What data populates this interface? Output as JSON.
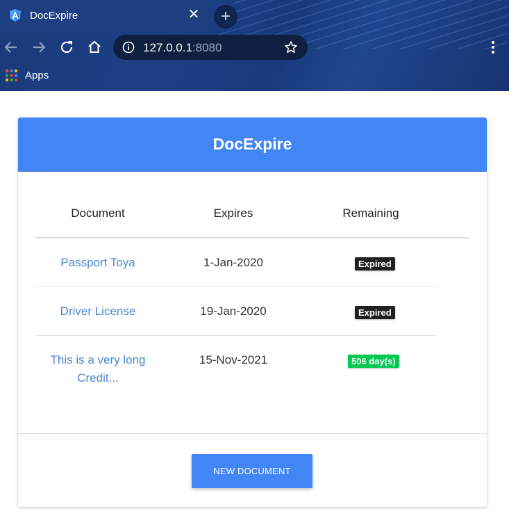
{
  "browser": {
    "tab": {
      "title": "DocExpire",
      "favicon": "angular-icon"
    },
    "address": {
      "host": "127.0.0.1",
      "port": ":8080"
    },
    "bookmarks": {
      "apps_label": "Apps"
    }
  },
  "card": {
    "title": "DocExpire",
    "columns": [
      "Document",
      "Expires",
      "Remaining"
    ],
    "rows": [
      {
        "document": "Passport Toya",
        "expires": "1-Jan-2020",
        "remaining": "Expired",
        "status": "expired"
      },
      {
        "document": "Driver License",
        "expires": "19-Jan-2020",
        "remaining": "Expired",
        "status": "expired"
      },
      {
        "document": "This is a very long Credit...",
        "expires": "15-Nov-2021",
        "remaining": "506 day(s)",
        "status": "ok"
      }
    ],
    "new_button": "NEW DOCUMENT"
  },
  "colors": {
    "primary": "#4285f4",
    "link": "#4a86d8",
    "expired_badge": "#212121",
    "ok_badge": "#00c851"
  }
}
